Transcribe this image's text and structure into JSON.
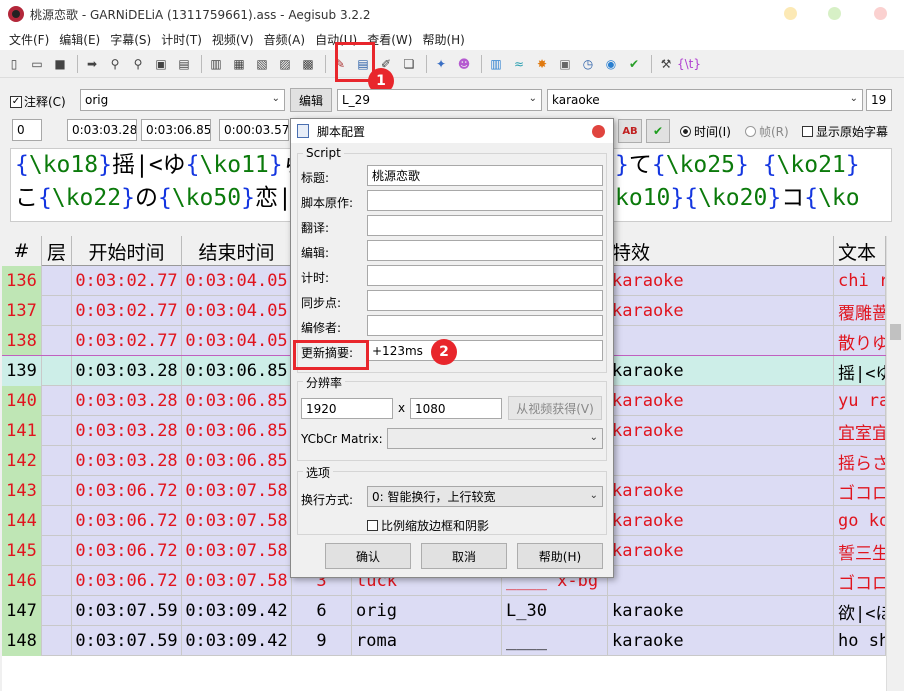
{
  "window": {
    "title": "桃源恋歌 - GARNiDELiA (1311759661).ass - Aegisub 3.2.2"
  },
  "menu": [
    "文件(F)",
    "编辑(E)",
    "字幕(S)",
    "计时(T)",
    "视频(V)",
    "音频(A)",
    "自动(U)",
    "查看(W)",
    "帮助(H)"
  ],
  "edit_row": {
    "comment_label": "注释(C)",
    "style": "orig",
    "edit_button": "编辑",
    "actor": "L_29",
    "effect": "karaoke",
    "margin": "19"
  },
  "time_row": {
    "layer": "0",
    "start": "0:03:03.28",
    "end": "0:03:06.85",
    "duration": "0:00:03.57",
    "ab": "AB",
    "radio_time": "时间(I)",
    "radio_frame": "帧(R)",
    "show_original": "显示原始字幕"
  },
  "text_edit": {
    "line1": [
      [
        "{",
        "\\ko18",
        "}"
      ],
      "摇|<ゆ",
      [
        "{",
        "\\ko11",
        "}"
      ],
      "ら",
      "…",
      [
        "}"
      ],
      "て",
      [
        "{",
        "\\ko25",
        "}"
      ],
      " ",
      [
        "{",
        "\\ko21",
        "}"
      ]
    ],
    "line1_text": "{\\ko18}摇|<ゆ{\\ko11}ら                    }て{\\ko25} {\\ko21}",
    "line2_text": "こ{\\ko22}の{\\ko50}恋|                 ko10}{\\ko20}コ{\\ko"
  },
  "grid": {
    "headers": [
      "#",
      "层",
      "开始时间",
      "结束时间",
      "",
      "",
      "",
      "特效",
      "文本"
    ],
    "rows": [
      {
        "n": "136",
        "layer": "",
        "start": "0:03:02.77",
        "end": "0:03:04.05",
        "margin": "",
        "style": "",
        "actor": "",
        "effect": "karaoke",
        "text": "chi ri",
        "red": true,
        "bg": "#dcdcf4"
      },
      {
        "n": "137",
        "layer": "",
        "start": "0:03:02.77",
        "end": "0:03:04.05",
        "margin": "",
        "style": "",
        "actor": "",
        "effect": "karaoke",
        "text": "覆雕蔷",
        "red": true,
        "bg": "#dcdcf4"
      },
      {
        "n": "138",
        "layer": "",
        "start": "0:03:02.77",
        "end": "0:03:04.05",
        "margin": "",
        "style": "",
        "actor": "",
        "effect": "",
        "text": "散りゆ",
        "red": true,
        "bg": "#dcdcf4"
      },
      {
        "n": "139",
        "layer": "",
        "start": "0:03:03.28",
        "end": "0:03:06.85",
        "margin": "",
        "style": "",
        "actor": "",
        "effect": "karaoke",
        "text": "摇|<ゆ",
        "red": false,
        "bg": "#cdeee8"
      },
      {
        "n": "140",
        "layer": "",
        "start": "0:03:03.28",
        "end": "0:03:06.85",
        "margin": "",
        "style": "",
        "actor": "",
        "effect": "karaoke",
        "text": "yu ra",
        "red": true,
        "bg": "#dcdcf4"
      },
      {
        "n": "141",
        "layer": "",
        "start": "0:03:03.28",
        "end": "0:03:06.85",
        "margin": "",
        "style": "",
        "actor": "",
        "effect": "karaoke",
        "text": "宜室宜",
        "red": true,
        "bg": "#dcdcf4"
      },
      {
        "n": "142",
        "layer": "",
        "start": "0:03:03.28",
        "end": "0:03:06.85",
        "margin": "",
        "style": "",
        "actor": "",
        "effect": "",
        "text": "摇らさ",
        "red": true,
        "bg": "#dcdcf4"
      },
      {
        "n": "143",
        "layer": "",
        "start": "0:03:06.72",
        "end": "0:03:07.58",
        "margin": "",
        "style": "",
        "actor": "",
        "effect": "karaoke",
        "text": "ゴコロ",
        "red": true,
        "bg": "#dcdcf4"
      },
      {
        "n": "144",
        "layer": "",
        "start": "0:03:06.72",
        "end": "0:03:07.58",
        "margin": "",
        "style": "",
        "actor": "",
        "effect": "karaoke",
        "text": "go ko",
        "red": true,
        "bg": "#dcdcf4"
      },
      {
        "n": "145",
        "layer": "",
        "start": "0:03:06.72",
        "end": "0:03:07.58",
        "margin": "",
        "style": "",
        "actor": "",
        "effect": "karaoke",
        "text": "誓三生",
        "red": true,
        "bg": "#dcdcf4"
      },
      {
        "n": "146",
        "layer": "",
        "start": "0:03:06.72",
        "end": "0:03:07.58",
        "margin": "3",
        "style": "tuck",
        "actor": "____ x-bg",
        "effect": "",
        "text": "ゴコロ",
        "red": true,
        "bg": "#dcdcf4"
      },
      {
        "n": "147",
        "layer": "",
        "start": "0:03:07.59",
        "end": "0:03:09.42",
        "margin": "6",
        "style": "orig",
        "actor": "L_30",
        "effect": "karaoke",
        "text": "欲|<ほ",
        "red": false,
        "bg": "#dcdcf4"
      },
      {
        "n": "148",
        "layer": "",
        "start": "0:03:07.59",
        "end": "0:03:09.42",
        "margin": "9",
        "style": "roma",
        "actor": "____",
        "effect": "karaoke",
        "text": "ho shi",
        "red": false,
        "bg": "#dcdcf4"
      }
    ]
  },
  "dialog": {
    "title": "脚本配置",
    "script_group": "Script",
    "fields": [
      {
        "label": "标题:",
        "value": "桃源恋歌"
      },
      {
        "label": "脚本原作:",
        "value": ""
      },
      {
        "label": "翻译:",
        "value": ""
      },
      {
        "label": "编辑:",
        "value": ""
      },
      {
        "label": "计时:",
        "value": ""
      },
      {
        "label": "同步点:",
        "value": ""
      },
      {
        "label": "编修者:",
        "value": ""
      },
      {
        "label": "更新摘要:",
        "value": "+123ms"
      }
    ],
    "resolution_group": "分辨率",
    "res_w": "1920",
    "res_x": "x",
    "res_h": "1080",
    "from_video": "从视频获得(V)",
    "ycbcr_label": "YCbCr Matrix:",
    "ycbcr_value": "",
    "options_group": "选项",
    "wrap_label": "换行方式:",
    "wrap_value": "0: 智能换行，上行较宽",
    "scale_label": "比例缩放边框和阴影",
    "ok": "确认",
    "cancel": "取消",
    "help": "帮助(H)"
  },
  "callouts": {
    "one": "1",
    "two": "2"
  },
  "colors": {
    "accent_red": "#e8262c",
    "comment_red": "#e0141e",
    "brace_blue": "#1436e0",
    "tag_green": "#0b7a0b"
  }
}
